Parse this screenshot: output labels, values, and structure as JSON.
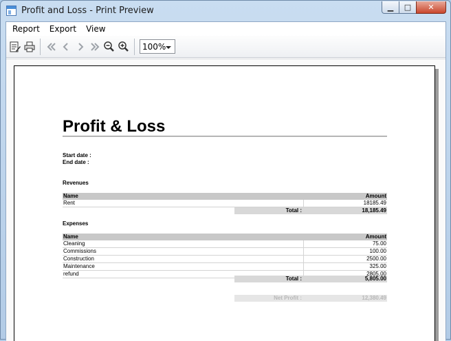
{
  "window": {
    "title": "Profit and Loss - Print Preview",
    "minimize_glyph": "▁",
    "maximize_glyph": "□",
    "close_glyph": "✕"
  },
  "menu": [
    "Report",
    "Export",
    "View"
  ],
  "toolbar": {
    "buttons": [
      "edit-report-icon",
      "print-icon",
      "first-page-icon",
      "previous-page-icon",
      "next-page-icon",
      "last-page-icon",
      "zoom-out-icon",
      "zoom-in-icon"
    ],
    "zoom_value": "100%"
  },
  "report": {
    "title": "Profit & Loss",
    "start_date_label": "Start date :",
    "end_date_label": "End date :",
    "revenues": {
      "heading": "Revenues",
      "col_name": "Name",
      "col_amount": "Amount",
      "rows": [
        {
          "name": "Rent",
          "amount": "18185.49"
        }
      ],
      "total_label": "Total :",
      "total_value": "18,185.49"
    },
    "expenses": {
      "heading": "Expenses",
      "col_name": "Name",
      "col_amount": "Amount",
      "rows": [
        {
          "name": "Cleaning",
          "amount": "75.00"
        },
        {
          "name": "Commissions",
          "amount": "100.00"
        },
        {
          "name": "Construction",
          "amount": "2500.00"
        },
        {
          "name": "Maintenance",
          "amount": "325.00"
        },
        {
          "name": "refund",
          "amount": "2805.00"
        }
      ],
      "total_label": "Total :",
      "total_value": "5,805.00"
    },
    "net_profit_label": "Net Profit :",
    "net_profit_value": "12,380.49"
  },
  "colors": {
    "window_frame": "#c9ddf1",
    "close_button": "#c9462c",
    "table_header": "#c8c8c8",
    "total_bar": "#d8d8d8"
  }
}
